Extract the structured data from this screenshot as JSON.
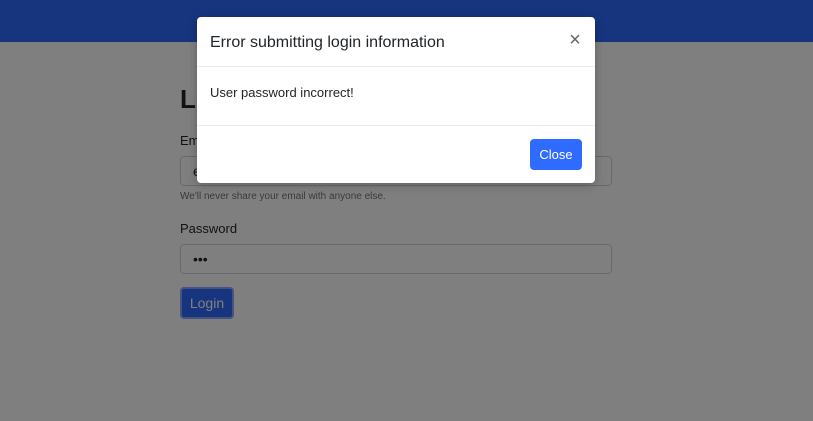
{
  "login": {
    "title": "Login",
    "email_label": "Email",
    "email_value": "e",
    "email_help": "We'll never share your email with anyone else.",
    "password_label": "Password",
    "password_value": "•••",
    "button_label": "Login"
  },
  "modal": {
    "title": "Error submitting login information",
    "message": "User password incorrect!",
    "close_icon_glyph": "×",
    "close_button_label": "Close"
  },
  "colors": {
    "primary": "#2f6bff",
    "overlay": "rgba(0,0,0,0.5)"
  }
}
